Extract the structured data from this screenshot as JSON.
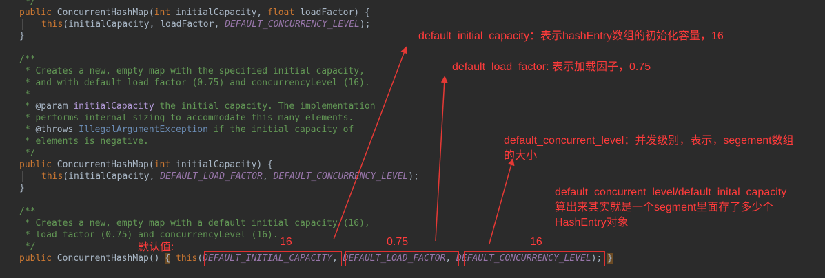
{
  "code_lines": [
    {
      "id": "l0",
      "y": -6,
      "html": "comment_close_top"
    },
    {
      "id": "l1",
      "y": 10
    },
    {
      "id": "l2",
      "y": 27
    },
    {
      "id": "l3",
      "y": 44
    }
  ],
  "code": {
    "l0": " */",
    "l1_public": "public ",
    "l1_sig": "ConcurrentHashMap(",
    "l1_int": "int ",
    "l1_p1": "initialCapacity, ",
    "l1_float": "float ",
    "l1_p2": "loadFactor) {",
    "l2_this": "this",
    "l2_args": "(initialCapacity, loadFactor, ",
    "l2_const": "DEFAULT_CONCURRENCY_LEVEL",
    "l2_end": ");",
    "l3": "}",
    "c1": "/**",
    "c2": " * Creates a new, empty map with the specified initial capacity,",
    "c3": " * and with default load factor (0.75) and concurrencyLevel (16).",
    "c4": " *",
    "c5_star": " * ",
    "c5_tag": "@param ",
    "c5_ref": "initialCapacity",
    "c5_rest": " the initial capacity. The implementation",
    "c6": " * performs internal sizing to accommodate this many elements.",
    "c7_star": " * ",
    "c7_tag": "@throws ",
    "c7_ref": "IllegalArgumentException",
    "c7_rest": " if the initial capacity of",
    "c8": " * elements is negative.",
    "c9": " */",
    "m2_public": "public ",
    "m2_sig": "ConcurrentHashMap(",
    "m2_int": "int ",
    "m2_p": "initialCapacity) {",
    "m2b_this": "this",
    "m2b_args": "(initialCapacity, ",
    "m2b_c1": "DEFAULT_LOAD_FACTOR",
    "m2b_sep": ", ",
    "m2b_c2": "DEFAULT_CONCURRENCY_LEVEL",
    "m2b_end": ");",
    "m2_close": "}",
    "d1": "/**",
    "d2": " * Creates a new, empty map with a default initial capacity (16),",
    "d3": " * load factor (0.75) and concurrencyLevel (16).",
    "d4": " */",
    "m3_public": "public ",
    "m3_sig": "ConcurrentHashMap() ",
    "m3_brace": "{",
    "m3_this": " this",
    "m3_paren": "(",
    "m3_c1": "DEFAULT_INITIAL_CAPACITY",
    "m3_sep1": ", ",
    "m3_c2": "DEFAULT_LOAD_FACTOR",
    "m3_sep2": ", ",
    "m3_c3": "DEFAULT_CONCURRENCY_LEVEL",
    "m3_end": "); ",
    "m3_close": "}"
  },
  "annotations": {
    "initial_capacity": "default_initial_capacity：表示hashEntry数组的初始化容量，16",
    "load_factor": "default_load_factor: 表示加载因子，0.75",
    "concurrent_level_1": "default_concurrent_level：并发级别，表示，segement数组",
    "concurrent_level_2": "的大小",
    "ratio_1": "default_concurrent_level/default_inital_capacity",
    "ratio_2": "算出来其实就是一个segment里面存了多少个",
    "ratio_3": "HashEntry对象",
    "default_values_label": "默认值:",
    "value_16_a": "16",
    "value_075": "0.75",
    "value_16_b": "16"
  },
  "colors": {
    "background": "#2b2b2b",
    "annotation_red": "#ff3b3b",
    "comment_green": "#629755",
    "keyword_orange": "#cc7832",
    "constant_purple": "#9876aa"
  }
}
